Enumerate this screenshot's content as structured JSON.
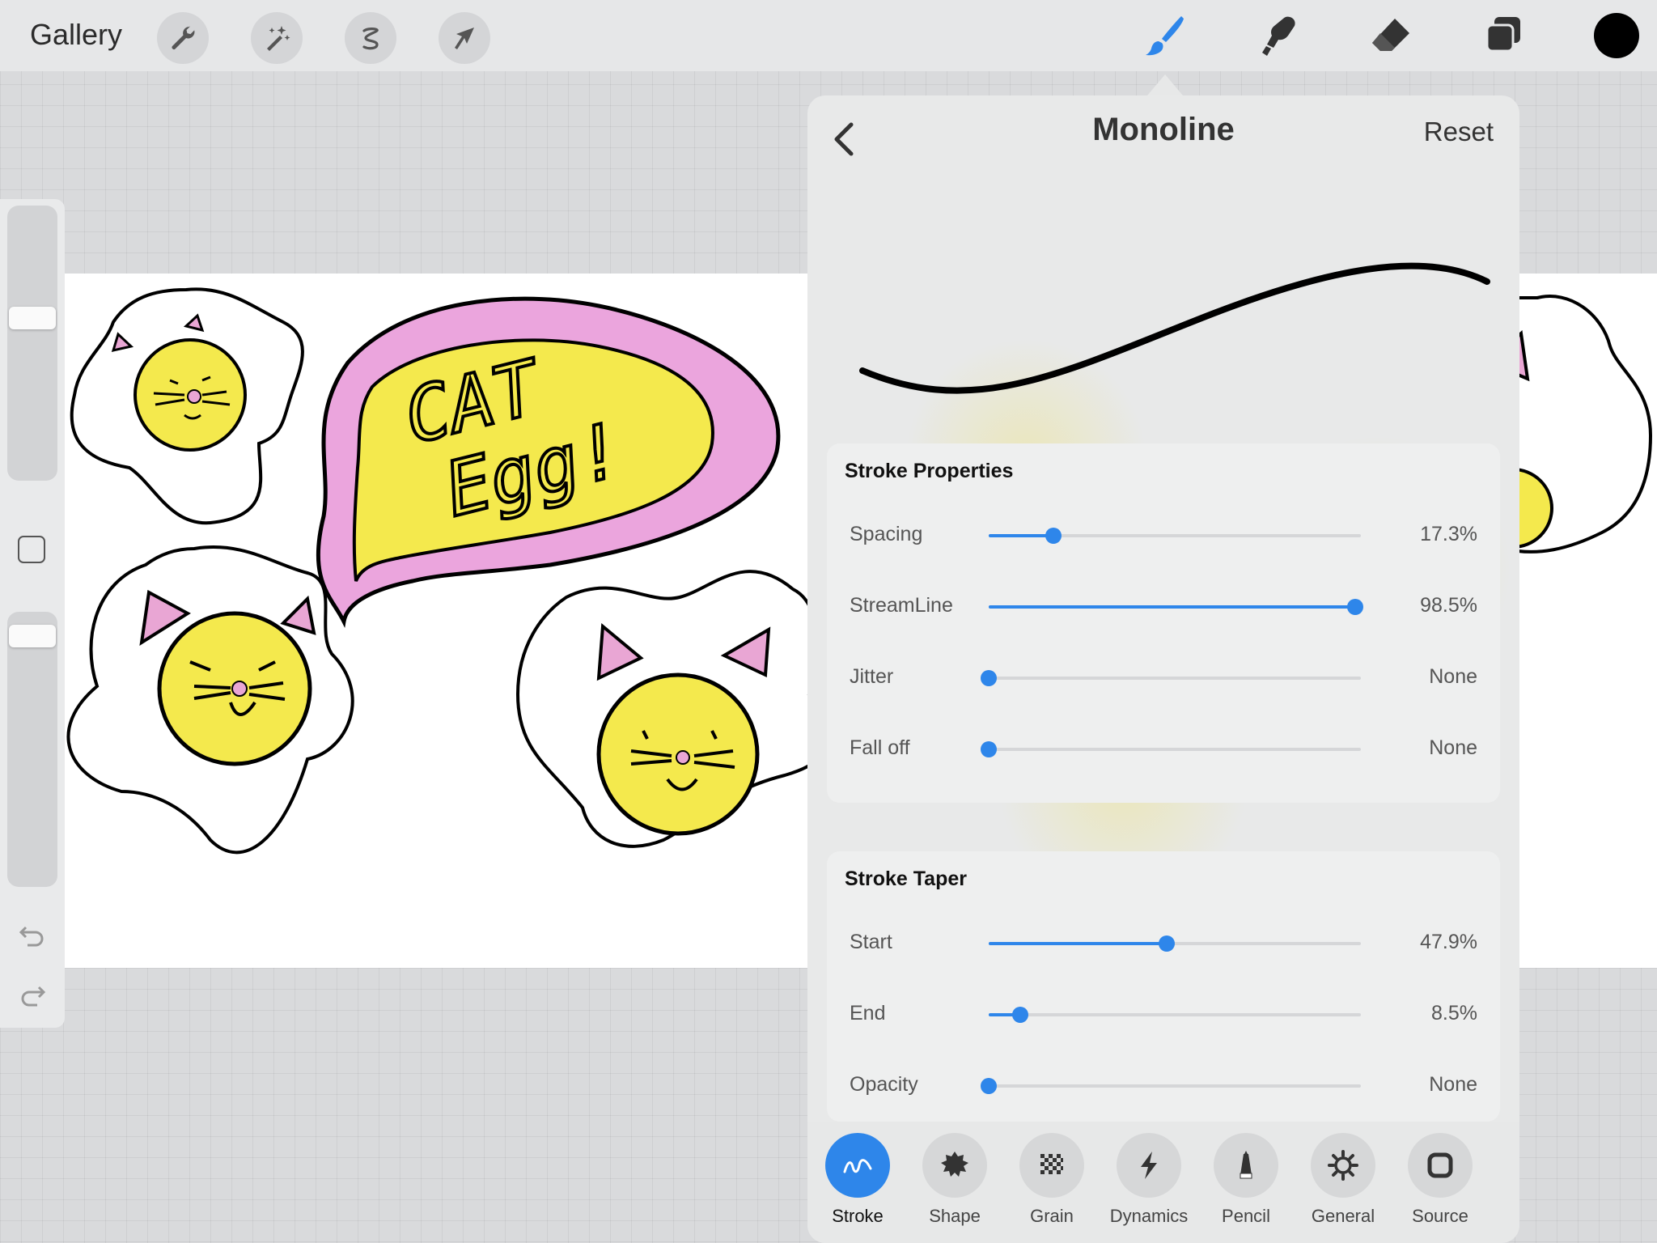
{
  "topbar": {
    "gallery_label": "Gallery",
    "left_tools": [
      "wrench-icon",
      "magic-wand-icon",
      "selection-icon",
      "transform-arrow-icon"
    ],
    "right_tools": [
      "brush-icon",
      "smudge-icon",
      "eraser-icon",
      "layers-icon"
    ],
    "active_tool": "brush-icon",
    "current_color": "#000000",
    "accent_color": "#2e86ea"
  },
  "canvas": {
    "speech_text_line1": "CAT",
    "speech_text_line2": "Egg!",
    "yolk_color": "#f4e94d",
    "bubble_color": "#eba5dd"
  },
  "sidebar": {
    "brush_size_level": 0.6,
    "opacity_level": 0.95,
    "icons": [
      "modify-button-icon",
      "undo-icon",
      "redo-icon"
    ]
  },
  "panel": {
    "title": "Monoline",
    "reset_label": "Reset",
    "sections": [
      {
        "title": "Stroke Properties",
        "rows": [
          {
            "label": "Spacing",
            "value": "17.3%",
            "level": 0.173
          },
          {
            "label": "StreamLine",
            "value": "98.5%",
            "level": 0.985
          },
          {
            "label": "Jitter",
            "value": "None",
            "level": 0
          },
          {
            "label": "Fall off",
            "value": "None",
            "level": 0
          }
        ]
      },
      {
        "title": "Stroke Taper",
        "rows": [
          {
            "label": "Start",
            "value": "47.9%",
            "level": 0.479
          },
          {
            "label": "End",
            "value": "8.5%",
            "level": 0.085
          },
          {
            "label": "Opacity",
            "value": "None",
            "level": 0
          }
        ]
      }
    ],
    "tabs": [
      {
        "label": "Stroke",
        "icon": "stroke-path-icon",
        "active": true
      },
      {
        "label": "Shape",
        "icon": "shape-icon",
        "active": false
      },
      {
        "label": "Grain",
        "icon": "grain-icon",
        "active": false
      },
      {
        "label": "Dynamics",
        "icon": "dynamics-bolt-icon",
        "active": false
      },
      {
        "label": "Pencil",
        "icon": "pencil-icon",
        "active": false
      },
      {
        "label": "General",
        "icon": "gear-icon",
        "active": false
      },
      {
        "label": "Source",
        "icon": "source-icon",
        "active": false
      }
    ]
  }
}
